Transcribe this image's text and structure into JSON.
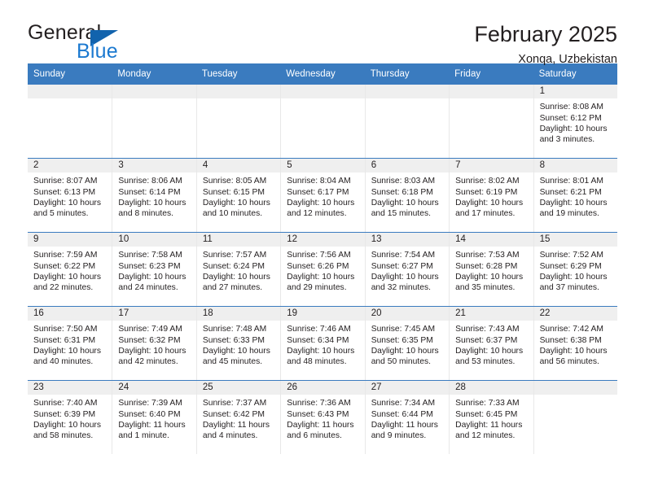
{
  "brand": {
    "name_top": "General",
    "name_bottom": "Blue"
  },
  "header": {
    "title": "February 2025",
    "subtitle": "Xonqa, Uzbekistan"
  },
  "colors": {
    "header_blue": "#3a7bbf",
    "logo_blue": "#1b79d0",
    "daynum_strip": "#efefef"
  },
  "weekdays": [
    "Sunday",
    "Monday",
    "Tuesday",
    "Wednesday",
    "Thursday",
    "Friday",
    "Saturday"
  ],
  "weeks": [
    [
      {
        "day": "",
        "empty": true
      },
      {
        "day": "",
        "empty": true
      },
      {
        "day": "",
        "empty": true
      },
      {
        "day": "",
        "empty": true
      },
      {
        "day": "",
        "empty": true
      },
      {
        "day": "",
        "empty": true
      },
      {
        "day": "1",
        "sunrise": "Sunrise: 8:08 AM",
        "sunset": "Sunset: 6:12 PM",
        "daylight": "Daylight: 10 hours and 3 minutes."
      }
    ],
    [
      {
        "day": "2",
        "sunrise": "Sunrise: 8:07 AM",
        "sunset": "Sunset: 6:13 PM",
        "daylight": "Daylight: 10 hours and 5 minutes."
      },
      {
        "day": "3",
        "sunrise": "Sunrise: 8:06 AM",
        "sunset": "Sunset: 6:14 PM",
        "daylight": "Daylight: 10 hours and 8 minutes."
      },
      {
        "day": "4",
        "sunrise": "Sunrise: 8:05 AM",
        "sunset": "Sunset: 6:15 PM",
        "daylight": "Daylight: 10 hours and 10 minutes."
      },
      {
        "day": "5",
        "sunrise": "Sunrise: 8:04 AM",
        "sunset": "Sunset: 6:17 PM",
        "daylight": "Daylight: 10 hours and 12 minutes."
      },
      {
        "day": "6",
        "sunrise": "Sunrise: 8:03 AM",
        "sunset": "Sunset: 6:18 PM",
        "daylight": "Daylight: 10 hours and 15 minutes."
      },
      {
        "day": "7",
        "sunrise": "Sunrise: 8:02 AM",
        "sunset": "Sunset: 6:19 PM",
        "daylight": "Daylight: 10 hours and 17 minutes."
      },
      {
        "day": "8",
        "sunrise": "Sunrise: 8:01 AM",
        "sunset": "Sunset: 6:21 PM",
        "daylight": "Daylight: 10 hours and 19 minutes."
      }
    ],
    [
      {
        "day": "9",
        "sunrise": "Sunrise: 7:59 AM",
        "sunset": "Sunset: 6:22 PM",
        "daylight": "Daylight: 10 hours and 22 minutes."
      },
      {
        "day": "10",
        "sunrise": "Sunrise: 7:58 AM",
        "sunset": "Sunset: 6:23 PM",
        "daylight": "Daylight: 10 hours and 24 minutes."
      },
      {
        "day": "11",
        "sunrise": "Sunrise: 7:57 AM",
        "sunset": "Sunset: 6:24 PM",
        "daylight": "Daylight: 10 hours and 27 minutes."
      },
      {
        "day": "12",
        "sunrise": "Sunrise: 7:56 AM",
        "sunset": "Sunset: 6:26 PM",
        "daylight": "Daylight: 10 hours and 29 minutes."
      },
      {
        "day": "13",
        "sunrise": "Sunrise: 7:54 AM",
        "sunset": "Sunset: 6:27 PM",
        "daylight": "Daylight: 10 hours and 32 minutes."
      },
      {
        "day": "14",
        "sunrise": "Sunrise: 7:53 AM",
        "sunset": "Sunset: 6:28 PM",
        "daylight": "Daylight: 10 hours and 35 minutes."
      },
      {
        "day": "15",
        "sunrise": "Sunrise: 7:52 AM",
        "sunset": "Sunset: 6:29 PM",
        "daylight": "Daylight: 10 hours and 37 minutes."
      }
    ],
    [
      {
        "day": "16",
        "sunrise": "Sunrise: 7:50 AM",
        "sunset": "Sunset: 6:31 PM",
        "daylight": "Daylight: 10 hours and 40 minutes."
      },
      {
        "day": "17",
        "sunrise": "Sunrise: 7:49 AM",
        "sunset": "Sunset: 6:32 PM",
        "daylight": "Daylight: 10 hours and 42 minutes."
      },
      {
        "day": "18",
        "sunrise": "Sunrise: 7:48 AM",
        "sunset": "Sunset: 6:33 PM",
        "daylight": "Daylight: 10 hours and 45 minutes."
      },
      {
        "day": "19",
        "sunrise": "Sunrise: 7:46 AM",
        "sunset": "Sunset: 6:34 PM",
        "daylight": "Daylight: 10 hours and 48 minutes."
      },
      {
        "day": "20",
        "sunrise": "Sunrise: 7:45 AM",
        "sunset": "Sunset: 6:35 PM",
        "daylight": "Daylight: 10 hours and 50 minutes."
      },
      {
        "day": "21",
        "sunrise": "Sunrise: 7:43 AM",
        "sunset": "Sunset: 6:37 PM",
        "daylight": "Daylight: 10 hours and 53 minutes."
      },
      {
        "day": "22",
        "sunrise": "Sunrise: 7:42 AM",
        "sunset": "Sunset: 6:38 PM",
        "daylight": "Daylight: 10 hours and 56 minutes."
      }
    ],
    [
      {
        "day": "23",
        "sunrise": "Sunrise: 7:40 AM",
        "sunset": "Sunset: 6:39 PM",
        "daylight": "Daylight: 10 hours and 58 minutes."
      },
      {
        "day": "24",
        "sunrise": "Sunrise: 7:39 AM",
        "sunset": "Sunset: 6:40 PM",
        "daylight": "Daylight: 11 hours and 1 minute."
      },
      {
        "day": "25",
        "sunrise": "Sunrise: 7:37 AM",
        "sunset": "Sunset: 6:42 PM",
        "daylight": "Daylight: 11 hours and 4 minutes."
      },
      {
        "day": "26",
        "sunrise": "Sunrise: 7:36 AM",
        "sunset": "Sunset: 6:43 PM",
        "daylight": "Daylight: 11 hours and 6 minutes."
      },
      {
        "day": "27",
        "sunrise": "Sunrise: 7:34 AM",
        "sunset": "Sunset: 6:44 PM",
        "daylight": "Daylight: 11 hours and 9 minutes."
      },
      {
        "day": "28",
        "sunrise": "Sunrise: 7:33 AM",
        "sunset": "Sunset: 6:45 PM",
        "daylight": "Daylight: 11 hours and 12 minutes."
      },
      {
        "day": "",
        "empty": true
      }
    ]
  ]
}
